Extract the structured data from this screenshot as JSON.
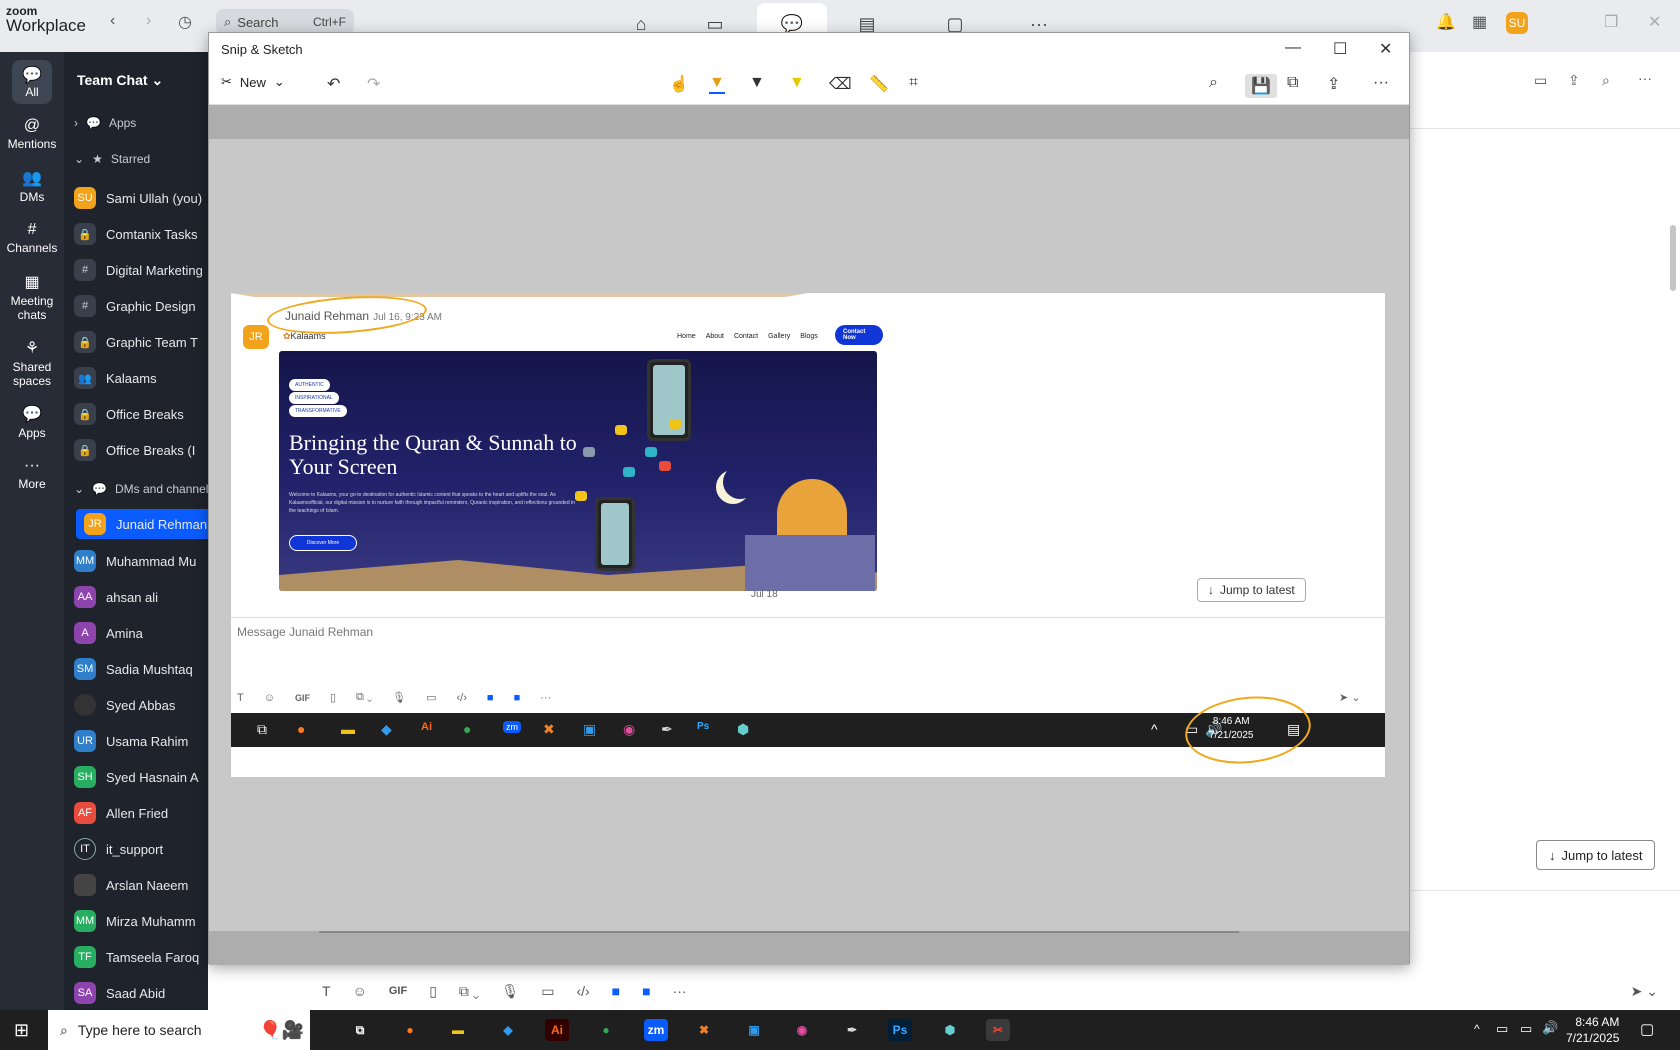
{
  "topbar": {
    "logo_top": "zoom",
    "logo_bottom": "Workplace",
    "search_placeholder": "Search",
    "search_shortcut": "Ctrl+F",
    "user_initials": "SU"
  },
  "rail": {
    "items": [
      {
        "label": "All",
        "icon": "chat-icon"
      },
      {
        "label": "Mentions",
        "icon": "at-icon"
      },
      {
        "label": "DMs",
        "icon": "people-icon"
      },
      {
        "label": "Channels",
        "icon": "hash-icon"
      },
      {
        "label": "Meeting chats",
        "icon": "calendar-icon"
      },
      {
        "label": "Shared spaces",
        "icon": "share-icon"
      },
      {
        "label": "Apps",
        "icon": "apps-icon"
      },
      {
        "label": "More",
        "icon": "more-icon"
      }
    ]
  },
  "sidebar": {
    "title": "Team Chat",
    "sections": {
      "apps": "Apps",
      "starred": "Starred",
      "dms": "DMs and channels"
    },
    "starred": [
      {
        "name": "Sami Ullah (you)",
        "initials": "SU",
        "color": "#f3a21c"
      },
      {
        "name": "Comtanix Tasks",
        "initials": "",
        "color": "lock"
      },
      {
        "name": "Digital Marketing",
        "initials": "",
        "color": "hash"
      },
      {
        "name": "Graphic Design",
        "initials": "",
        "color": "hash"
      },
      {
        "name": "Graphic Team T",
        "initials": "",
        "color": "lock"
      },
      {
        "name": "Kalaams",
        "initials": "",
        "color": "group"
      },
      {
        "name": "Office Breaks",
        "initials": "",
        "color": "lock"
      },
      {
        "name": "Office Breaks (I",
        "initials": "",
        "color": "lock"
      }
    ],
    "dms": [
      {
        "name": "Junaid Rehman",
        "initials": "JR",
        "color": "#f3a21c"
      },
      {
        "name": "Muhammad Mu",
        "initials": "MM",
        "color": "#2f7ec9"
      },
      {
        "name": "ahsan ali",
        "initials": "AA",
        "color": "#8e44ad"
      },
      {
        "name": "Amina",
        "initials": "A",
        "color": "#8e44ad"
      },
      {
        "name": "Sadia Mushtaq",
        "initials": "SM",
        "color": "#2f7ec9"
      },
      {
        "name": "Syed Abbas",
        "initials": "",
        "color": "#333"
      },
      {
        "name": "Usama Rahim",
        "initials": "UR",
        "color": "#2f7ec9"
      },
      {
        "name": "Syed Hasnain A",
        "initials": "SH",
        "color": "#27ae60"
      },
      {
        "name": "Allen Fried",
        "initials": "AF",
        "color": "#e74c3c"
      },
      {
        "name": "it_support",
        "initials": "IT",
        "color": "#1e232c"
      },
      {
        "name": "Arslan Naeem",
        "initials": "",
        "color": "#444"
      },
      {
        "name": "Mirza Muhamm",
        "initials": "MM",
        "color": "#27ae60"
      },
      {
        "name": "Tamseela Faroq",
        "initials": "TF",
        "color": "#27ae60"
      },
      {
        "name": "Saad Abid",
        "initials": "SA",
        "color": "#8e44ad"
      }
    ]
  },
  "snip": {
    "title": "Snip & Sketch",
    "new_label": "New"
  },
  "capture": {
    "sender": "Junaid Rehman",
    "time": "Jul 16, 9:23 AM",
    "avatar": "JR",
    "site": {
      "logo": "Kalaams",
      "links": [
        "Home",
        "About",
        "Contact",
        "Gallery",
        "Blogs"
      ],
      "cta": "Contact Now",
      "tags": [
        "AUTHENTIC",
        "INSPIRATIONAL",
        "TRANSFORMATIVE"
      ],
      "headline": "Bringing the Quran & Sunnah to Your Screen",
      "body": "Welcome to Kalaams, your go-to destination for authentic Islamic content that speaks to the heart and uplifts the soul. As Kalaamsofficial, our digital mission is to nurture faith through impactful reminders, Quranic inspiration, and reflections grounded in the teachings of Islam.",
      "button": "Discover More"
    },
    "date_divider": "Jul 18",
    "jump_label": "Jump to latest",
    "message_placeholder": "Message Junaid Rehman",
    "clock_time": "8:46 AM",
    "clock_date": "7/21/2025"
  },
  "right": {
    "jump_label": "Jump to latest"
  },
  "taskbar": {
    "search_placeholder": "Type here to search",
    "time": "8:46 AM",
    "date": "7/21/2025"
  },
  "composer": {
    "gif_label": "GIF"
  }
}
